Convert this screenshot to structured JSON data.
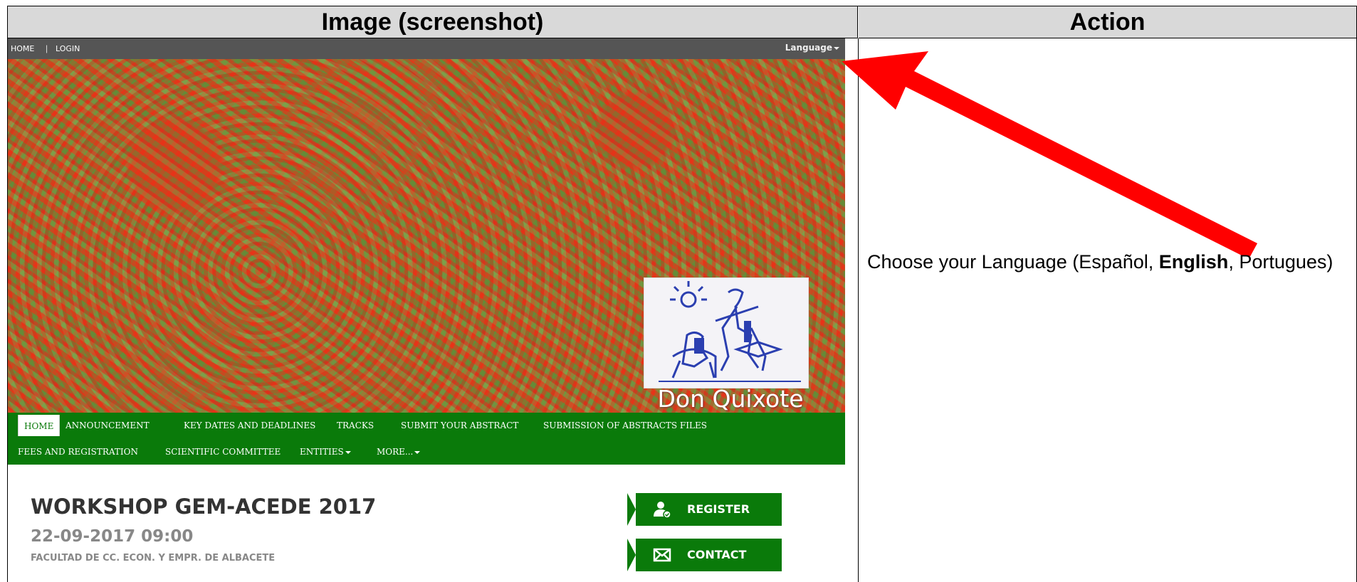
{
  "table": {
    "col_image_header": "Image (screenshot)",
    "col_action_header": "Action"
  },
  "screenshot": {
    "topbar": {
      "home": "HOME",
      "separator": "|",
      "login": "LOGIN",
      "language": "Language"
    },
    "banner": {
      "caption": "Don Quixote"
    },
    "nav": {
      "row1": [
        "HOME",
        "ANNOUNCEMENT",
        "KEY DATES AND DEADLINES",
        "TRACKS",
        "SUBMIT YOUR ABSTRACT",
        "SUBMISSION OF ABSTRACTS FILES"
      ],
      "row2": [
        "FEES AND REGISTRATION",
        "SCIENTIFIC COMMITTEE",
        "ENTITIES",
        "MORE..."
      ]
    },
    "event": {
      "title": "WORKSHOP GEM-ACEDE 2017",
      "date": "22-09-2017 09:00",
      "venue": "FACULTAD DE CC. ECON. Y EMPR. DE ALBACETE"
    },
    "buttons": {
      "register": "REGISTER",
      "contact": "CONTACT"
    }
  },
  "action": {
    "prefix": "Choose your Language (Español, ",
    "bold": "English",
    "suffix": ", Portugues)"
  },
  "colors": {
    "nav_green": "#0a7a0a",
    "topbar_gray": "#555555",
    "arrow_red": "#ff0000"
  }
}
